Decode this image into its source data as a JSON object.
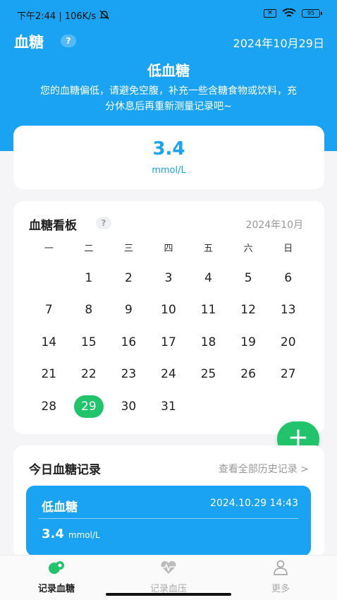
{
  "status_bar": {
    "time_speed": "下午2:44 | 106K/s",
    "sim_icon_text": "×",
    "battery_level": "95"
  },
  "header": {
    "title": "血糖",
    "help_label": "?",
    "date": "2024年10月29日"
  },
  "status": {
    "level": "低血糖",
    "tip": "您的血糖偏低，请避免空腹，补充一些含糖食物或饮料，充分休息后再重新测量记录吧~"
  },
  "current_reading": {
    "value": "3.4",
    "unit": "mmol/L"
  },
  "calendar": {
    "title": "血糖看板",
    "help_label": "?",
    "month": "2024年10月",
    "weekdays": [
      "一",
      "二",
      "三",
      "四",
      "五",
      "六",
      "日"
    ],
    "first_day_offset": 1,
    "days_in_month": 31,
    "today": 29
  },
  "fab_label": "+",
  "records": {
    "title": "今日血糖记录",
    "view_all": "查看全部历史记录 >",
    "items": [
      {
        "status": "低血糖",
        "time": "2024.10.29  14:43",
        "value": "3.4",
        "unit": "mmol/L"
      }
    ]
  },
  "tabbar": {
    "items": [
      {
        "label": "记录血糖",
        "icon": "blood-glucose-icon",
        "active": true
      },
      {
        "label": "记录血压",
        "icon": "heartbeat-icon",
        "active": false
      },
      {
        "label": "更多",
        "icon": "user-icon",
        "active": false
      }
    ]
  },
  "colors": {
    "primary": "#1aa3f2",
    "accent": "#21c46b"
  }
}
